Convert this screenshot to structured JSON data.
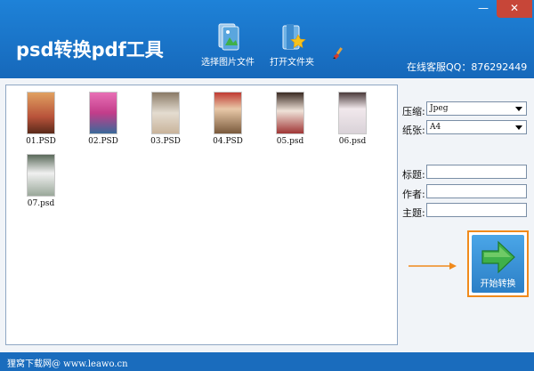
{
  "window": {
    "title": "psd转换pdf工具",
    "minimize": "—",
    "close": "✕"
  },
  "toolbar": {
    "select_images": "选择图片文件",
    "open_folder": "打开文件夹",
    "icons": [
      "photos-icon",
      "folder-star-icon",
      "brush-icon"
    ]
  },
  "service": "在线客服QQ：876292449",
  "files": [
    {
      "name": "01.PSD",
      "color": "#b8523a"
    },
    {
      "name": "02.PSD",
      "color": "#c23d8a"
    },
    {
      "name": "03.PSD",
      "color": "#c9b49b"
    },
    {
      "name": "04.PSD",
      "color": "#7a5a3c"
    },
    {
      "name": "05.psd",
      "color": "#a03636"
    },
    {
      "name": "06.psd",
      "color": "#d9d2d8"
    },
    {
      "name": "07.psd",
      "color": "#9aa89a"
    }
  ],
  "settings": {
    "compression_label": "压缩:",
    "compression_value": "Jpeg",
    "paper_label": "纸张:",
    "paper_value": "A4",
    "title_label": "标题:",
    "author_label": "作者:",
    "subject_label": "主题:"
  },
  "start_button": "开始转换",
  "accent": {
    "orange": "#f08a1c",
    "green": "#3fb04a",
    "blue": "#1a74c8"
  },
  "footer": "狸窝下载网@ www.leawo.cn"
}
